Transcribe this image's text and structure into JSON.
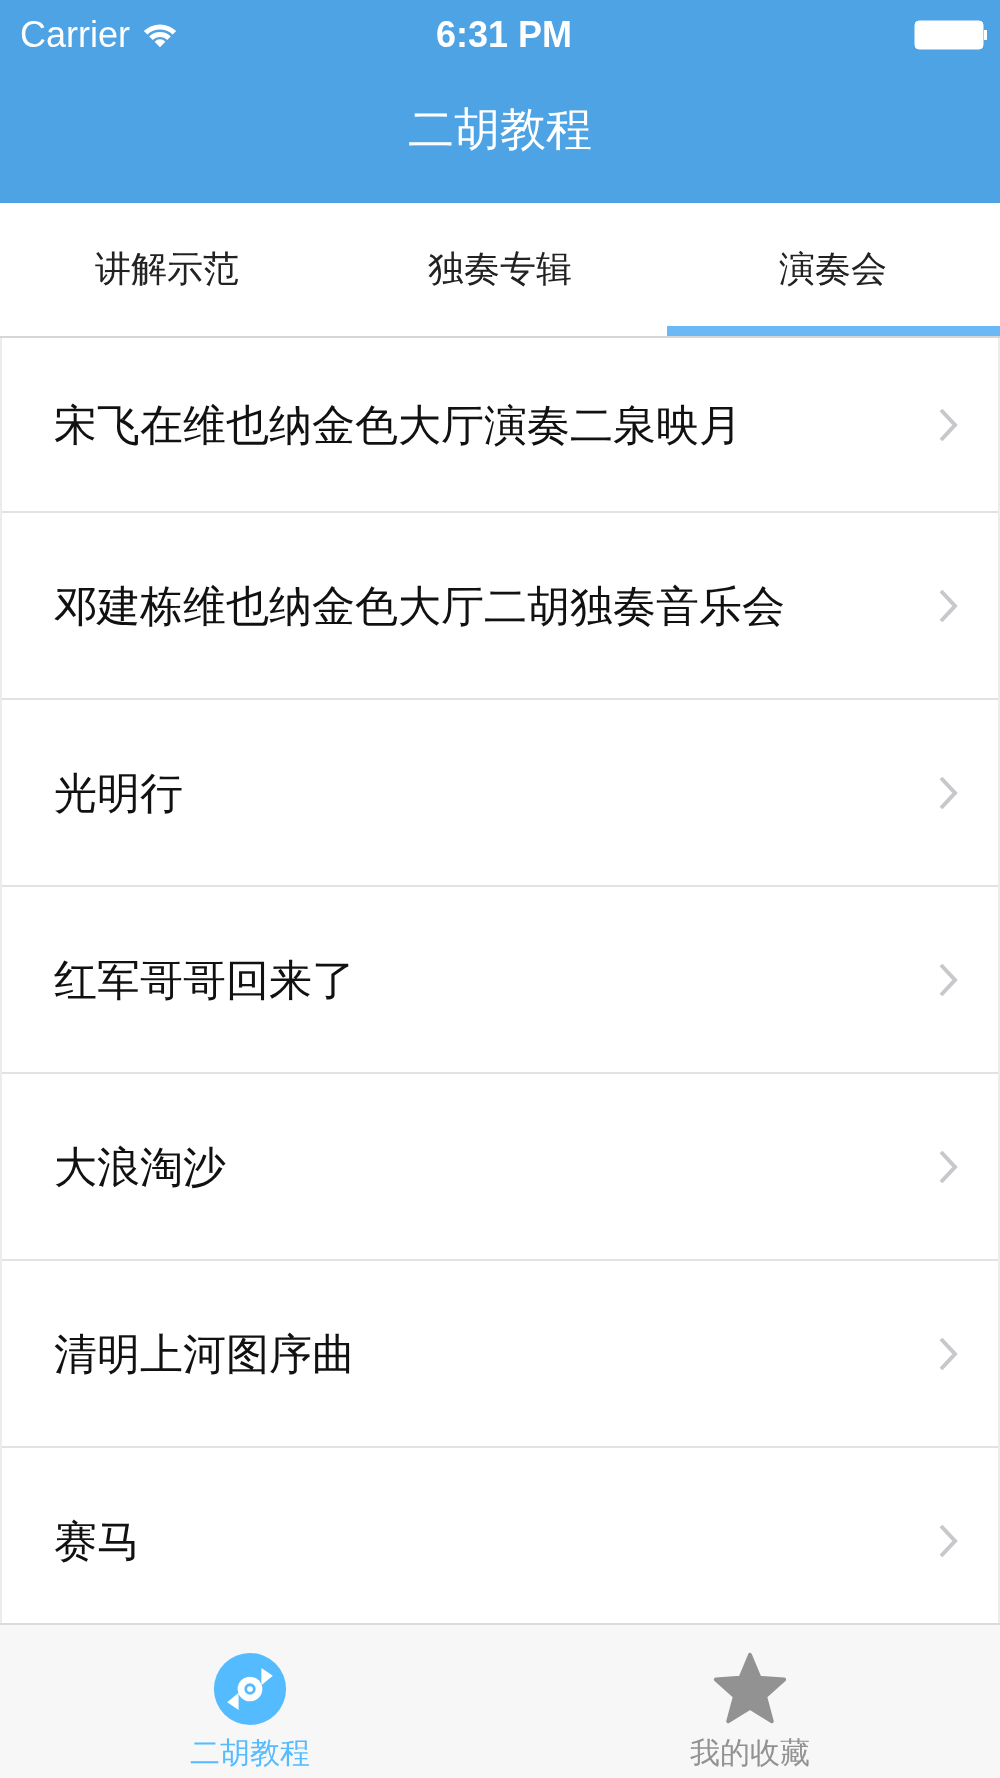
{
  "status_bar": {
    "carrier": "Carrier",
    "time": "6:31 PM"
  },
  "nav_bar": {
    "title": "二胡教程"
  },
  "tabs": [
    {
      "label": "讲解示范",
      "selected": false
    },
    {
      "label": "独奏专辑",
      "selected": false
    },
    {
      "label": "演奏会",
      "selected": true
    }
  ],
  "list": [
    {
      "title": "宋飞在维也纳金色大厅演奏二泉映月"
    },
    {
      "title": "邓建栋维也纳金色大厅二胡独奏音乐会"
    },
    {
      "title": "光明行"
    },
    {
      "title": "红军哥哥回来了"
    },
    {
      "title": "大浪淘沙"
    },
    {
      "title": "清明上河图序曲"
    },
    {
      "title": "赛马"
    }
  ],
  "tab_bar": [
    {
      "label": "二胡教程",
      "kind": "disc",
      "selected": true
    },
    {
      "label": "我的收藏",
      "kind": "star",
      "selected": false
    }
  ]
}
